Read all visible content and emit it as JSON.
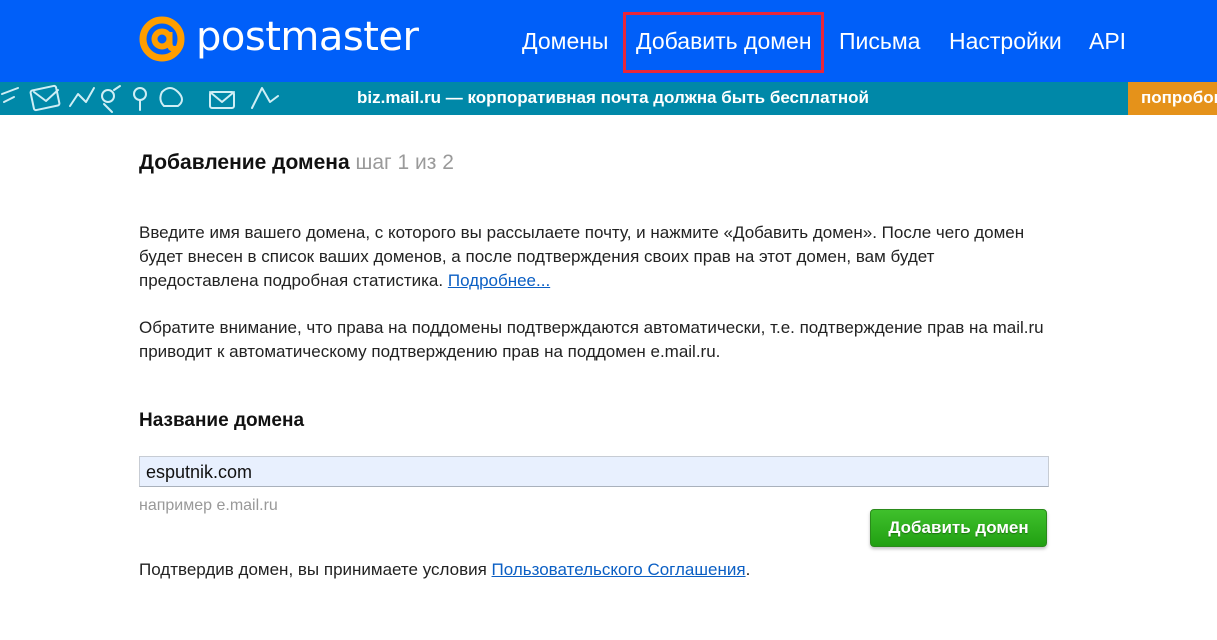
{
  "header": {
    "logo_text": "postmaster",
    "nav": [
      {
        "label": "Домены"
      },
      {
        "label": "Добавить домен",
        "active": true
      },
      {
        "label": "Письма"
      },
      {
        "label": "Настройки"
      },
      {
        "label": "API"
      }
    ],
    "colors": {
      "background": "#005ff9",
      "logo_accent": "#ff9e00",
      "active_outline": "#e8263b"
    }
  },
  "banner": {
    "text": "biz.mail.ru — корпоративная почта должна быть бесплатной",
    "cta_label": "попробов",
    "colors": {
      "background": "#0088a8",
      "cta": "#e5921a"
    }
  },
  "main": {
    "title": "Добавление домена",
    "step": "шаг 1 из 2",
    "paragraph1": "Введите имя вашего домена, с которого вы рассылаете почту, и нажмите «Добавить домен». После чего домен будет внесен в список ваших доменов, а после подтверждения своих прав на этот домен, вам будет предоставлена подробная статистика.",
    "more_link": "Подробнее...",
    "paragraph2": "Обратите внимание, что права на поддомены подтверждаются автоматически, т.е. подтверждение прав на mail.ru приводит к автоматическому подтверждению прав на поддомен e.mail.ru.",
    "field_label": "Название домена",
    "input_value": "esputnik.com",
    "hint": "например e.mail.ru",
    "add_button_label": "Добавить домен",
    "terms_prefix": "Подтвердив домен, вы принимаете условия",
    "terms_link": "Пользовательского Соглашения",
    "terms_suffix": "."
  }
}
